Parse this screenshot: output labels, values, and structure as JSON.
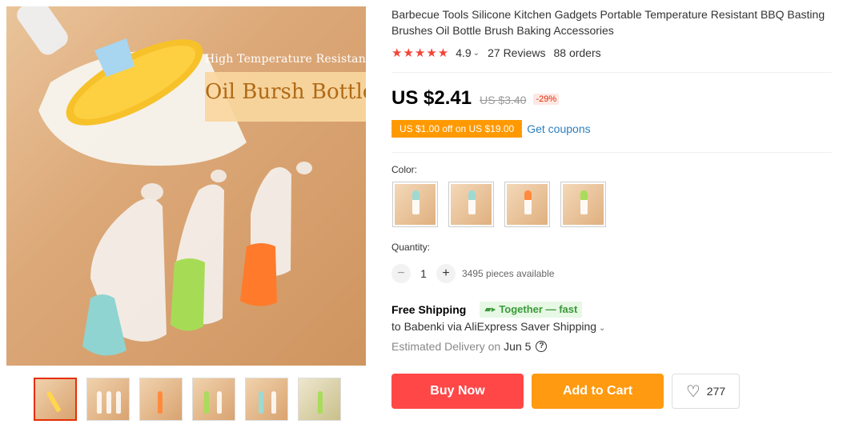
{
  "product": {
    "title": "Barbecue Tools Silicone Kitchen Gadgets Portable Temperature Resistant BBQ Basting Brushes Oil Bottle Brush Baking Accessories",
    "image_banner_line1": "High Temperature Resistant",
    "image_banner_line2": "Oil Bursh Bottle"
  },
  "rating": {
    "stars": "★★★★★",
    "value": "4.9",
    "reviews": "27 Reviews",
    "orders": "88 orders"
  },
  "price": {
    "current": "US $2.41",
    "original": "US $3.40",
    "discount": "-29%"
  },
  "coupon": {
    "tag": "US $1.00 off on US $19.00",
    "link": "Get coupons"
  },
  "color": {
    "label": "Color:",
    "swatch_brush_colors": [
      "#9ed9d2",
      "#9ed9d2",
      "#ff8a3d",
      "#a8dc5a"
    ]
  },
  "quantity": {
    "label": "Quantity:",
    "minus": "−",
    "value": "1",
    "plus": "+",
    "available": "3495 pieces available"
  },
  "shipping": {
    "free": "Free Shipping",
    "badge": "Together — fast",
    "destination": "to Babenki via AliExpress Saver Shipping",
    "estimated_label": "Estimated Delivery on",
    "estimated_date": "Jun 5"
  },
  "actions": {
    "buy_now": "Buy Now",
    "add_to_cart": "Add to Cart",
    "wishlist_count": "277"
  },
  "colors": {
    "buy_now": "#ff4747",
    "add_to_cart": "#ff9a11",
    "rating_stars": "#f44336",
    "coupon": "#ff9900",
    "link": "#2b7fbe"
  }
}
